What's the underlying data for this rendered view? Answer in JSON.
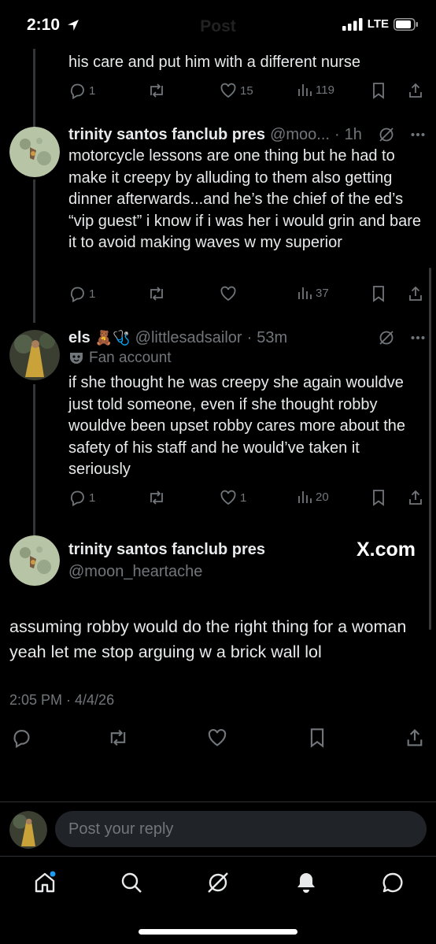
{
  "status_bar": {
    "time": "2:10",
    "nav_title": "Post",
    "network": "LTE"
  },
  "tweets": [
    {
      "text_tail": "his care and put him with a different nurse",
      "replies": "1",
      "reposts": "",
      "likes": "15",
      "views": "119"
    },
    {
      "name": "trinity santos fanclub pres",
      "handle": "@moo...",
      "time": "1h",
      "text": "motorcycle lessons are one thing but he had to make it creepy by alluding to them also getting dinner afterwards...and he’s the chief of the ed’s “vip guest” i know if i was her i would grin and bare it to avoid making waves w my superior",
      "replies": "1",
      "reposts": "",
      "likes": "",
      "views": "37"
    },
    {
      "name": "els",
      "name_emojis": "🧸🩺",
      "handle": "@littlesadsailor",
      "time": "53m",
      "label": "Fan account",
      "text": "if she thought he was creepy she again wouldve just told someone, even if she thought robby wouldve been upset robby cares more about the safety of his staff and he would’ve taken it seriously",
      "replies": "1",
      "reposts": "",
      "likes": "1",
      "views": "20"
    }
  ],
  "main_post": {
    "name": "trinity santos fanclub pres",
    "handle": "@moon_heartache",
    "watermark": "X.com",
    "text": "assuming robby would do the right thing for a woman yeah let me stop arguing w a brick wall lol",
    "timestamp": "2:05 PM · 4/4/26"
  },
  "reply": {
    "placeholder": "Post your reply"
  },
  "bottom_nav": [
    "home-icon",
    "search-icon",
    "grok-icon",
    "notifications-icon",
    "messages-icon"
  ],
  "colors": {
    "background": "#000000",
    "text": "#e7e9ea",
    "muted": "#71767b",
    "accent": "#1d9bf0"
  }
}
